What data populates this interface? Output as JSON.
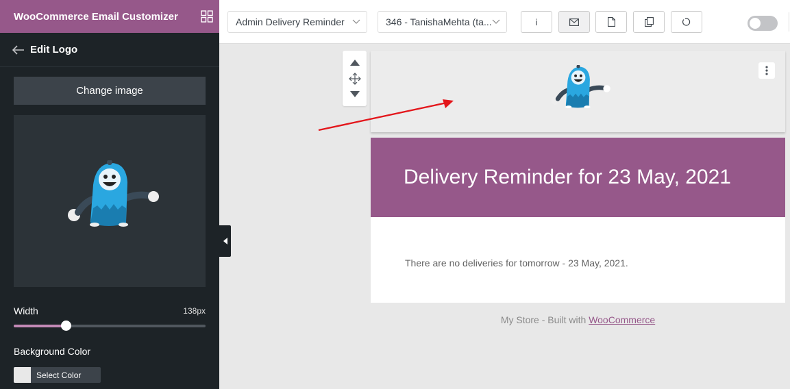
{
  "sidebar": {
    "app_title": "WooCommerce Email Customizer",
    "panel_title": "Edit Logo",
    "change_image_label": "Change image",
    "width_label": "Width",
    "width_value": "138px",
    "width_slider_fraction": 0.27,
    "background_color_label": "Background Color",
    "select_color_label": "Select Color"
  },
  "topbar": {
    "email_type_select": "Admin Delivery Reminder",
    "order_select": "346 - TanishaMehta (ta...",
    "info_button_label": "i",
    "toggle_state": "off"
  },
  "email": {
    "heading": "Delivery Reminder for 23 May, 2021",
    "body_text": "There are no deliveries for tomorrow - 23 May, 2021.",
    "footer_prefix": "My Store - Built with ",
    "footer_link": "WooCommerce"
  },
  "colors": {
    "brand": "#96588a",
    "sidebar_bg": "#1d2327",
    "canvas_bg": "#e8e8e8",
    "annotation_arrow": "#e3161b"
  },
  "icons": {
    "grid": "grid-icon",
    "back": "arrow-left-icon",
    "collapse": "caret-left-icon",
    "move_up": "triangle-up-icon",
    "move": "move-arrows-icon",
    "move_down": "triangle-down-icon",
    "more": "vertical-dots-icon",
    "email": "envelope-icon",
    "document": "document-icon",
    "copy": "copy-icon",
    "reset": "reset-icon"
  }
}
